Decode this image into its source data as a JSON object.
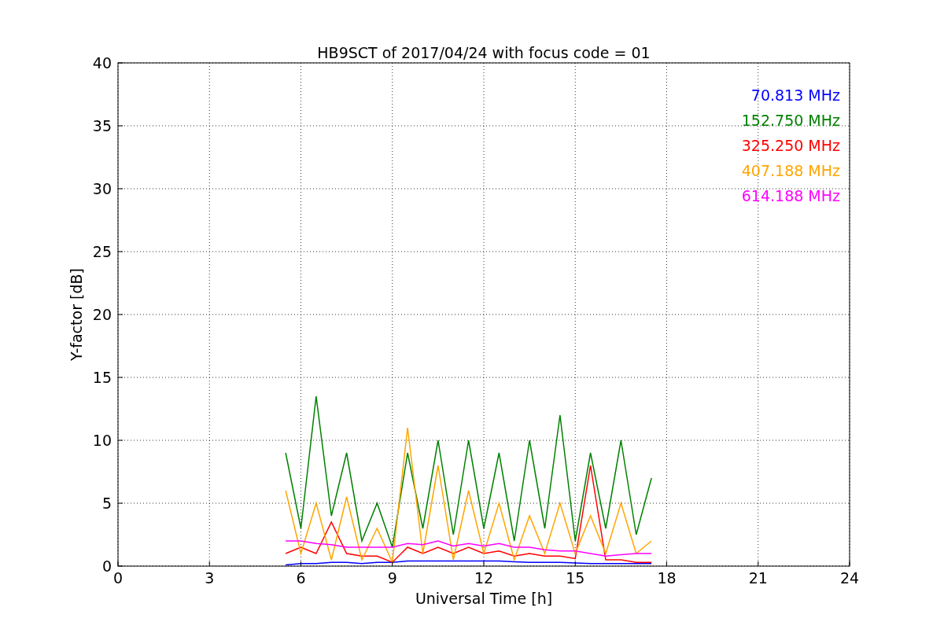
{
  "chart_data": {
    "type": "line",
    "title": "HB9SCT of 2017/04/24 with focus code = 01",
    "xlabel": "Universal Time [h]",
    "ylabel": "Y-factor [dB]",
    "x": [
      5.5,
      6,
      6.5,
      7,
      7.5,
      8,
      8.5,
      9,
      9.5,
      10,
      10.5,
      11,
      11.5,
      12,
      12.5,
      13,
      13.5,
      14,
      14.5,
      15,
      15.5,
      16,
      16.5,
      17,
      17.5
    ],
    "series": [
      {
        "name": "70.813 MHz",
        "color": "#0000ff",
        "values": [
          0.1,
          0.2,
          0.2,
          0.3,
          0.3,
          0.2,
          0.3,
          0.3,
          0.4,
          0.4,
          0.4,
          0.4,
          0.4,
          0.4,
          0.4,
          0.35,
          0.3,
          0.3,
          0.3,
          0.25,
          0.2,
          0.2,
          0.2,
          0.2,
          0.2
        ]
      },
      {
        "name": "152.750 MHz",
        "color": "#008000",
        "values": [
          9,
          3,
          13.5,
          4,
          9,
          2,
          5,
          1.5,
          9,
          3,
          10,
          2.5,
          10,
          3,
          9,
          2,
          10,
          3,
          12,
          2,
          9,
          3,
          10,
          2.5,
          7
        ]
      },
      {
        "name": "325.250 MHz",
        "color": "#ff0000",
        "values": [
          1,
          1.5,
          1,
          3.5,
          1,
          0.8,
          0.8,
          0.3,
          1.5,
          1,
          1.5,
          1,
          1.5,
          1,
          1.2,
          0.8,
          1,
          0.8,
          0.8,
          0.6,
          8,
          0.5,
          0.5,
          0.3,
          0.3
        ]
      },
      {
        "name": "407.188 MHz",
        "color": "#ffa500",
        "values": [
          6,
          1,
          5,
          0.5,
          5.5,
          0.5,
          3,
          0.3,
          11,
          1,
          8,
          0.5,
          6,
          1,
          5,
          0.5,
          4,
          1,
          5,
          1,
          4,
          1,
          5,
          1,
          2
        ]
      },
      {
        "name": "614.188 MHz",
        "color": "#ff00ff",
        "values": [
          2,
          2,
          1.8,
          1.7,
          1.5,
          1.5,
          1.5,
          1.5,
          1.8,
          1.7,
          2,
          1.6,
          1.8,
          1.6,
          1.8,
          1.5,
          1.5,
          1.3,
          1.2,
          1.2,
          1,
          0.8,
          0.9,
          1,
          1
        ]
      }
    ],
    "grid": true,
    "xlim": [
      0,
      24
    ],
    "ylim": [
      0,
      40
    ],
    "xticks": [
      0,
      3,
      6,
      9,
      12,
      15,
      18,
      21,
      24
    ],
    "yticks": [
      0,
      5,
      10,
      15,
      20,
      25,
      30,
      35,
      40
    ]
  }
}
